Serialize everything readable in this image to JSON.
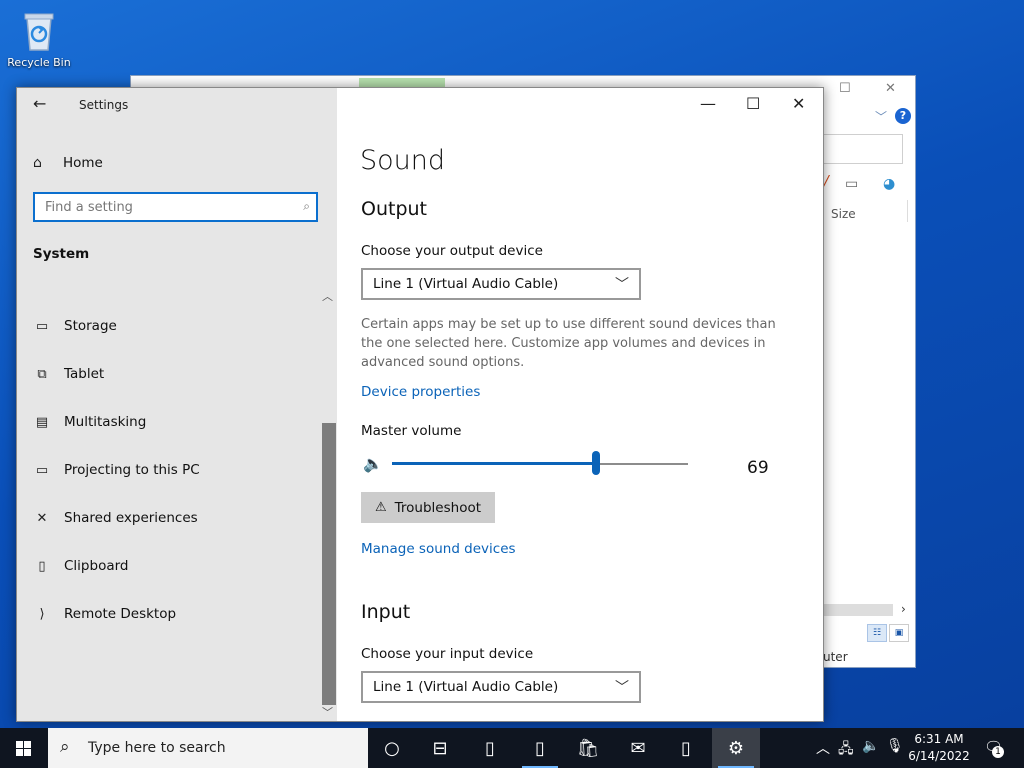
{
  "desktop": {
    "recycle_bin_label": "Recycle Bin"
  },
  "background_window": {
    "size_column": "Size",
    "status_text": "uter",
    "help_label": "?"
  },
  "settings": {
    "app_title": "Settings",
    "home_label": "Home",
    "search_placeholder": "Find a setting",
    "section_heading": "System",
    "nav_items": [
      {
        "label": "Storage",
        "icon": "storage-icon"
      },
      {
        "label": "Tablet",
        "icon": "tablet-icon"
      },
      {
        "label": "Multitasking",
        "icon": "multitasking-icon"
      },
      {
        "label": "Projecting to this PC",
        "icon": "projecting-icon"
      },
      {
        "label": "Shared experiences",
        "icon": "shared-experiences-icon"
      },
      {
        "label": "Clipboard",
        "icon": "clipboard-icon"
      },
      {
        "label": "Remote Desktop",
        "icon": "remote-desktop-icon"
      }
    ]
  },
  "sound": {
    "page_title": "Sound",
    "output_heading": "Output",
    "output_device_label": "Choose your output device",
    "output_device_value": "Line 1 (Virtual Audio Cable)",
    "output_note": "Certain apps may be set up to use different sound devices than the one selected here. Customize app volumes and devices in advanced sound options.",
    "device_properties_link": "Device properties",
    "master_volume_label": "Master volume",
    "master_volume_value": "69",
    "master_volume_level": 69,
    "troubleshoot_label": "Troubleshoot",
    "manage_devices_link": "Manage sound devices",
    "input_heading": "Input",
    "input_device_label": "Choose your input device",
    "input_device_value": "Line 1 (Virtual Audio Cable)"
  },
  "taskbar": {
    "search_placeholder": "Type here to search",
    "clock_time": "6:31 AM",
    "clock_date": "6/14/2022",
    "notification_count": "1"
  },
  "colors": {
    "accent": "#0b63b8",
    "sidebar_bg": "#e6e6e6",
    "taskbar_bg": "#0f1520"
  }
}
